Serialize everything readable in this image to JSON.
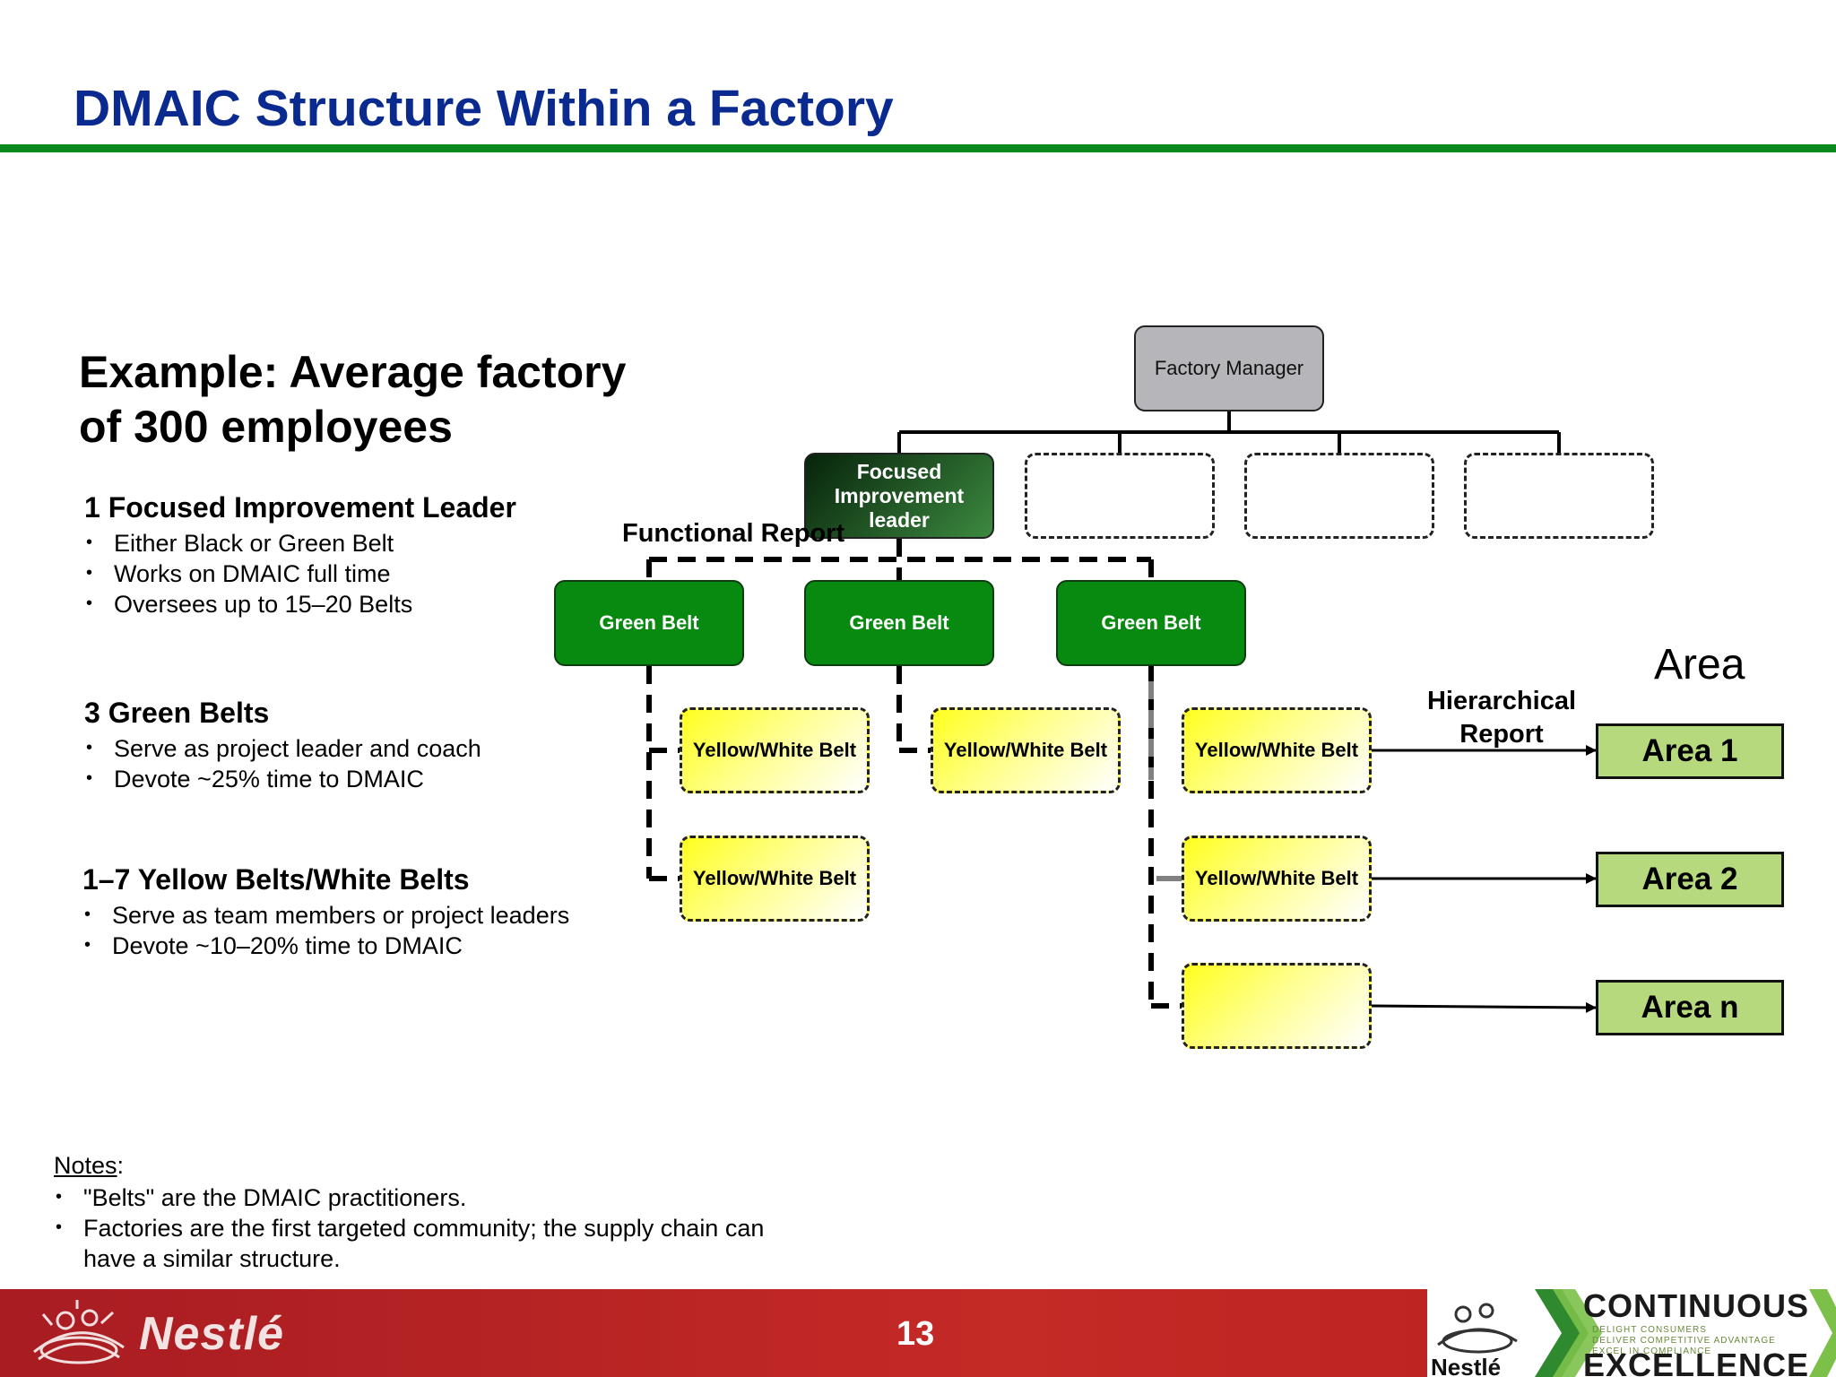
{
  "slide": {
    "title": "DMAIC Structure Within a Factory",
    "page_number": "13"
  },
  "left_panel": {
    "example_heading": "Example: Average factory of 300 employees",
    "sections": [
      {
        "heading": "1 Focused Improvement Leader",
        "bullets": [
          "Either Black or Green Belt",
          "Works on DMAIC full time",
          "Oversees up to 15–20 Belts"
        ]
      },
      {
        "heading": "3 Green Belts",
        "bullets": [
          "Serve as project leader and coach",
          "Devote ~25% time to DMAIC"
        ]
      },
      {
        "heading": "1–7 Yellow Belts/White Belts",
        "bullets": [
          "Serve as team members or project leaders",
          "Devote ~10–20% time to DMAIC"
        ]
      }
    ]
  },
  "notes": {
    "label": "Notes",
    "items": [
      "\"Belts\" are the DMAIC practitioners.",
      "Factories are the first targeted community; the supply chain can have a similar structure."
    ]
  },
  "diagram": {
    "factory_manager": "Factory Manager",
    "fi_leader": "Focused Improvement leader",
    "functional_report": "Functional Report",
    "hierarchical_report": "Hierarchical Report",
    "area_header": "Area",
    "green_belts": [
      "Green Belt",
      "Green Belt",
      "Green Belt"
    ],
    "yellow_white_belts": [
      "Yellow/White Belt",
      "Yellow/White Belt",
      "Yellow/White Belt",
      "Yellow/White Belt",
      "Yellow/White Belt",
      ""
    ],
    "areas": [
      "Area 1",
      "Area 2",
      "Area n"
    ]
  },
  "footer": {
    "brand": "Nestlé",
    "badge_top": "CONTINUOUS",
    "badge_bottom": "EXCELLENCE",
    "badge_lines": [
      "DELIGHT CONSUMERS",
      "DELIVER COMPETITIVE ADVANTAGE",
      "EXCEL IN COMPLIANCE"
    ],
    "badge_brand": "Nestlé"
  },
  "colors": {
    "title": "#0a2a8f",
    "rule": "#0a8a1e",
    "green_belt": "#088a11",
    "area_fill": "#b5d97c",
    "footer": "#c42a26"
  }
}
